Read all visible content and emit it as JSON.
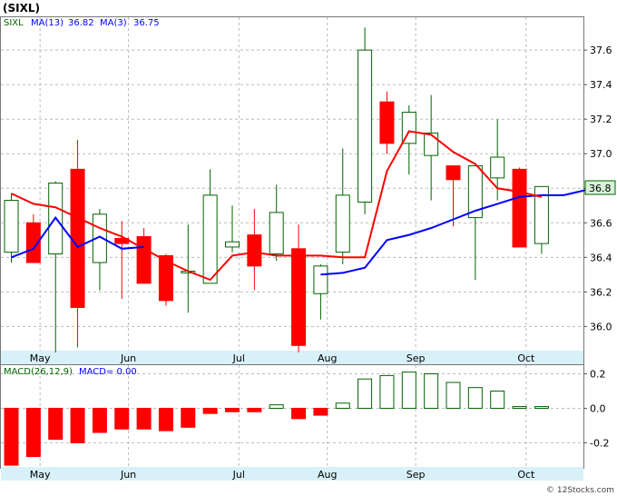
{
  "title": "(SIXL)",
  "legend": {
    "symbol": "SIXL",
    "ma13_label": "MA(13)",
    "ma13_value": "36.82",
    "ma3_label": "MA(3)",
    "ma3_value": "36.75"
  },
  "last_price_tag": "36.8",
  "macd_legend": {
    "label": "MACD(26,12,9)",
    "value_label": "MACD= 0.00"
  },
  "watermark": "© 12Stocks.com",
  "colors": {
    "up": "#006400",
    "down": "#ff0000",
    "ma13": "#0000ff",
    "ma3": "#ff0000",
    "price_tag_bg": "#d8f0d8",
    "axis_band": "#d8f0f8",
    "grid": "#bbbbbb"
  },
  "chart_data": [
    {
      "type": "candlestick",
      "x_ticks": [
        {
          "label": "May",
          "index": 1.3
        },
        {
          "label": "Jun",
          "index": 5.3
        },
        {
          "label": "Jul",
          "index": 10.3
        },
        {
          "label": "Aug",
          "index": 14.3
        },
        {
          "label": "Sep",
          "index": 18.3
        },
        {
          "label": "Oct",
          "index": 23.3
        }
      ],
      "y_ticks": [
        "36.0",
        "36.2",
        "36.4",
        "36.6",
        "36.8",
        "37.0",
        "37.2",
        "37.4",
        "37.6"
      ],
      "ylim": [
        35.86,
        37.79
      ],
      "grid": true,
      "candles": [
        {
          "open": 36.43,
          "high": 36.77,
          "low": 36.37,
          "close": 36.73
        },
        {
          "open": 36.6,
          "high": 36.65,
          "low": 36.37,
          "close": 36.37
        },
        {
          "open": 36.42,
          "high": 36.84,
          "low": 35.85,
          "close": 36.83
        },
        {
          "open": 36.91,
          "high": 37.08,
          "low": 35.88,
          "close": 36.11
        },
        {
          "open": 36.37,
          "high": 36.68,
          "low": 36.21,
          "close": 36.65
        },
        {
          "open": 36.51,
          "high": 36.61,
          "low": 36.16,
          "close": 36.48
        },
        {
          "open": 36.52,
          "high": 36.57,
          "low": 36.25,
          "close": 36.25
        },
        {
          "open": 36.41,
          "high": 36.42,
          "low": 36.12,
          "close": 36.15
        },
        {
          "open": 36.31,
          "high": 36.59,
          "low": 36.08,
          "close": 36.32
        },
        {
          "open": 36.25,
          "high": 36.91,
          "low": 36.25,
          "close": 36.76
        },
        {
          "open": 36.46,
          "high": 36.7,
          "low": 36.43,
          "close": 36.49
        },
        {
          "open": 36.53,
          "high": 36.68,
          "low": 36.21,
          "close": 36.35
        },
        {
          "open": 36.42,
          "high": 36.82,
          "low": 36.38,
          "close": 36.66
        },
        {
          "open": 36.45,
          "high": 36.59,
          "low": 35.85,
          "close": 35.89
        },
        {
          "open": 36.19,
          "high": 36.36,
          "low": 36.04,
          "close": 36.35
        },
        {
          "open": 36.43,
          "high": 37.03,
          "low": 36.36,
          "close": 36.76
        },
        {
          "open": 36.72,
          "high": 37.73,
          "low": 36.65,
          "close": 37.6
        },
        {
          "open": 37.3,
          "high": 37.36,
          "low": 37.0,
          "close": 37.06
        },
        {
          "open": 37.06,
          "high": 37.28,
          "low": 36.88,
          "close": 37.24
        },
        {
          "open": 36.99,
          "high": 37.34,
          "low": 36.73,
          "close": 37.12
        },
        {
          "open": 36.93,
          "high": 36.93,
          "low": 36.58,
          "close": 36.85
        },
        {
          "open": 36.63,
          "high": 36.94,
          "low": 36.27,
          "close": 36.93
        },
        {
          "open": 36.86,
          "high": 37.2,
          "low": 36.73,
          "close": 36.98
        },
        {
          "open": 36.91,
          "high": 36.92,
          "low": 36.46,
          "close": 36.46
        },
        {
          "open": 36.48,
          "high": 36.81,
          "low": 36.42,
          "close": 36.81
        }
      ],
      "series": [
        {
          "name": "MA(13)",
          "start_index": 14,
          "values": [
            36.3,
            36.31,
            36.34,
            36.5,
            36.53,
            36.57,
            36.62,
            36.67,
            36.71,
            36.75,
            36.76,
            36.76,
            36.79
          ]
        },
        {
          "name": "MA(3)",
          "start_index": 0,
          "values": [
            36.77,
            36.71,
            36.69,
            36.63,
            36.57,
            36.52,
            36.45,
            36.38,
            36.32,
            36.27,
            36.41,
            36.43,
            36.41,
            36.41,
            36.41,
            36.4,
            36.4,
            36.9,
            37.13,
            37.11,
            37.01,
            36.94,
            36.8,
            36.78,
            36.75
          ]
        },
        {
          "name": "MA(13) early",
          "start_index": 0,
          "values": [
            36.4,
            36.45,
            36.63,
            36.46,
            36.52,
            36.45,
            36.46
          ]
        }
      ]
    },
    {
      "type": "bar",
      "title": "MACD(26,12,9)",
      "y_ticks": [
        "0.2",
        "0.0",
        "-0.2"
      ],
      "ylim": [
        -0.34,
        0.25
      ],
      "values": [
        -0.33,
        -0.28,
        -0.18,
        -0.2,
        -0.14,
        -0.12,
        -0.12,
        -0.13,
        -0.11,
        -0.03,
        -0.02,
        -0.02,
        0.02,
        -0.06,
        -0.04,
        0.03,
        0.17,
        0.19,
        0.21,
        0.2,
        0.15,
        0.12,
        0.1,
        0.01,
        0.01
      ]
    }
  ]
}
